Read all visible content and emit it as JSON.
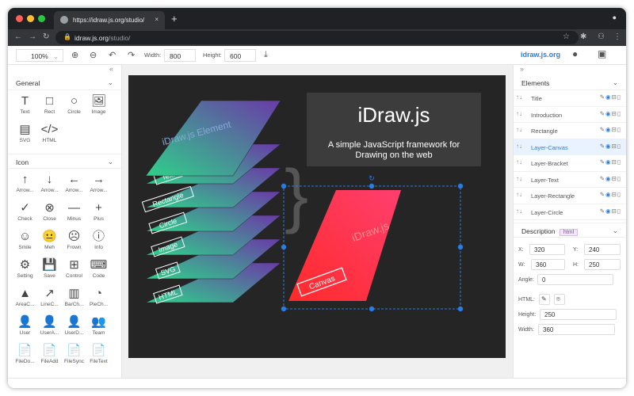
{
  "browser": {
    "tab_title": "https://idraw.js.org/studio/",
    "url_host": "idraw.js.org",
    "url_path": "/studio/",
    "close": "×",
    "new_tab": "+"
  },
  "toolbar": {
    "zoom": "100%",
    "width_label": "Width:",
    "width": "800",
    "height_label": "Height:",
    "height": "600",
    "brand": "idraw.js.org"
  },
  "left": {
    "general_title": "General",
    "general": [
      {
        "label": "Text",
        "icon": "T"
      },
      {
        "label": "Rect",
        "icon": "□"
      },
      {
        "label": "Circle",
        "icon": "○"
      },
      {
        "label": "Image",
        "icon": "🖼"
      },
      {
        "label": "SVG",
        "icon": "▤"
      },
      {
        "label": "HTML",
        "icon": "</>"
      }
    ],
    "icon_title": "Icon",
    "icons": [
      {
        "label": "Arrow...",
        "icon": "↑"
      },
      {
        "label": "Arrow...",
        "icon": "↓"
      },
      {
        "label": "Arrow...",
        "icon": "←"
      },
      {
        "label": "Arrow...",
        "icon": "→"
      },
      {
        "label": "Check",
        "icon": "✓"
      },
      {
        "label": "Close",
        "icon": "⊗"
      },
      {
        "label": "Minus",
        "icon": "—"
      },
      {
        "label": "Plus",
        "icon": "+"
      },
      {
        "label": "Smile",
        "icon": "☺"
      },
      {
        "label": "Meh",
        "icon": "😐"
      },
      {
        "label": "Frown",
        "icon": "☹"
      },
      {
        "label": "Info",
        "icon": "ⓘ"
      },
      {
        "label": "Setting",
        "icon": "⚙"
      },
      {
        "label": "Save",
        "icon": "💾"
      },
      {
        "label": "Control",
        "icon": "⊞"
      },
      {
        "label": "Code",
        "icon": "⌨"
      },
      {
        "label": "AreaC...",
        "icon": "▲"
      },
      {
        "label": "LineC...",
        "icon": "↗"
      },
      {
        "label": "BarCh...",
        "icon": "▥"
      },
      {
        "label": "PieCh...",
        "icon": "◔"
      },
      {
        "label": "User",
        "icon": "👤"
      },
      {
        "label": "UserA...",
        "icon": "👤"
      },
      {
        "label": "UserD...",
        "icon": "👤"
      },
      {
        "label": "Team",
        "icon": "👥"
      },
      {
        "label": "FileDo...",
        "icon": "📄"
      },
      {
        "label": "FileAdd",
        "icon": "📄"
      },
      {
        "label": "FileSync",
        "icon": "📄"
      },
      {
        "label": "FileText",
        "icon": "📄"
      }
    ]
  },
  "canvas": {
    "layers": [
      "iDraw.js Element",
      "Text",
      "Rectangle",
      "Circle",
      "Image",
      "SVG",
      "HTML"
    ],
    "title": "iDraw.js",
    "subtitle1": "A simple JavaScript framework for",
    "subtitle2": "Drawing on the web",
    "card_title": "iDraw.js",
    "card_label": "Canvas"
  },
  "right": {
    "elements_title": "Elements",
    "elements": [
      "Title",
      "Introduction",
      "Rectangle",
      "Layer-Canvas",
      "Layer-Bracket",
      "Layer-Text",
      "Layer-Rectangle",
      "Layer-Circle"
    ],
    "selected": "Layer-Canvas",
    "desc_title": "Description",
    "desc_badge": "html",
    "x_label": "X:",
    "x": "320",
    "y_label": "Y:",
    "y": "240",
    "w_label": "W:",
    "w": "360",
    "h_label": "H:",
    "h": "250",
    "angle_label": "Angle:",
    "angle": "0",
    "html_label": "HTML:",
    "height_label": "Height:",
    "height": "250",
    "width_label": "Width:",
    "width": "360"
  },
  "colors": {
    "accent": "#2a7be4",
    "canvas_bg": "#252525"
  }
}
